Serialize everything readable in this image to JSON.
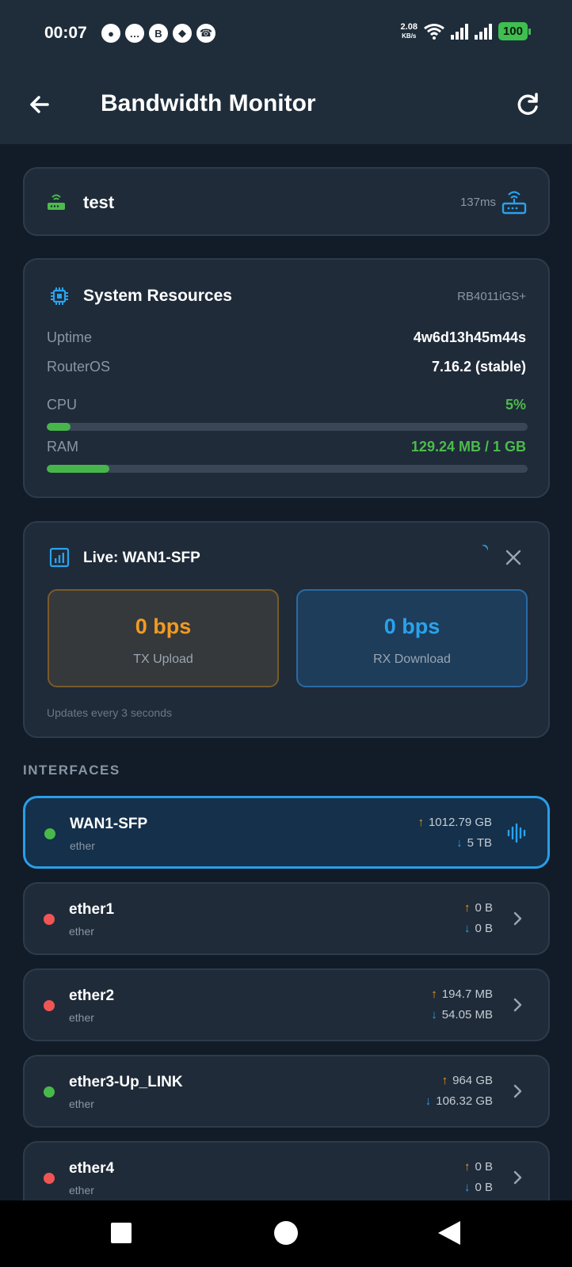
{
  "status_bar": {
    "time": "00:07",
    "notif_icons": [
      "chat-bubble-icon",
      "message-icon",
      "b-app-icon",
      "grid-diamond-icon",
      "viber-icon"
    ],
    "net_speed": "2.08",
    "net_speed_unit": "KB/s",
    "battery": "100"
  },
  "app_bar": {
    "title": "Bandwidth Monitor",
    "back_icon": "arrow-left-icon",
    "refresh_icon": "refresh-icon"
  },
  "router": {
    "name": "test",
    "ping": "137ms",
    "status_color": "#4cbb4c",
    "accent_color": "#2aa2ec"
  },
  "system": {
    "title": "System Resources",
    "model": "RB4011iGS+",
    "uptime_label": "Uptime",
    "uptime_value": "4w6d13h45m44s",
    "os_label": "RouterOS",
    "os_value": "7.16.2 (stable)",
    "cpu_label": "CPU",
    "cpu_value": "5%",
    "cpu_fraction": 0.05,
    "ram_label": "RAM",
    "ram_value": "129.24 MB / 1 GB",
    "ram_fraction": 0.13
  },
  "live": {
    "title": "Live: WAN1-SFP",
    "tx_value": "0 bps",
    "tx_label": "TX Upload",
    "rx_value": "0 bps",
    "rx_label": "RX Download",
    "note": "Updates every 3 seconds"
  },
  "interfaces": {
    "section_label": "INTERFACES",
    "items": [
      {
        "name": "WAN1-SFP",
        "type": "ether",
        "tx": "1012.79 GB",
        "rx": "5 TB",
        "status": "up",
        "active": true
      },
      {
        "name": "ether1",
        "type": "ether",
        "tx": "0 B",
        "rx": "0 B",
        "status": "down",
        "active": false
      },
      {
        "name": "ether2",
        "type": "ether",
        "tx": "194.7 MB",
        "rx": "54.05 MB",
        "status": "down",
        "active": false
      },
      {
        "name": "ether3-Up_LINK",
        "type": "ether",
        "tx": "964 GB",
        "rx": "106.32 GB",
        "status": "up",
        "active": false
      },
      {
        "name": "ether4",
        "type": "ether",
        "tx": "0 B",
        "rx": "0 B",
        "status": "down",
        "active": false
      }
    ]
  }
}
